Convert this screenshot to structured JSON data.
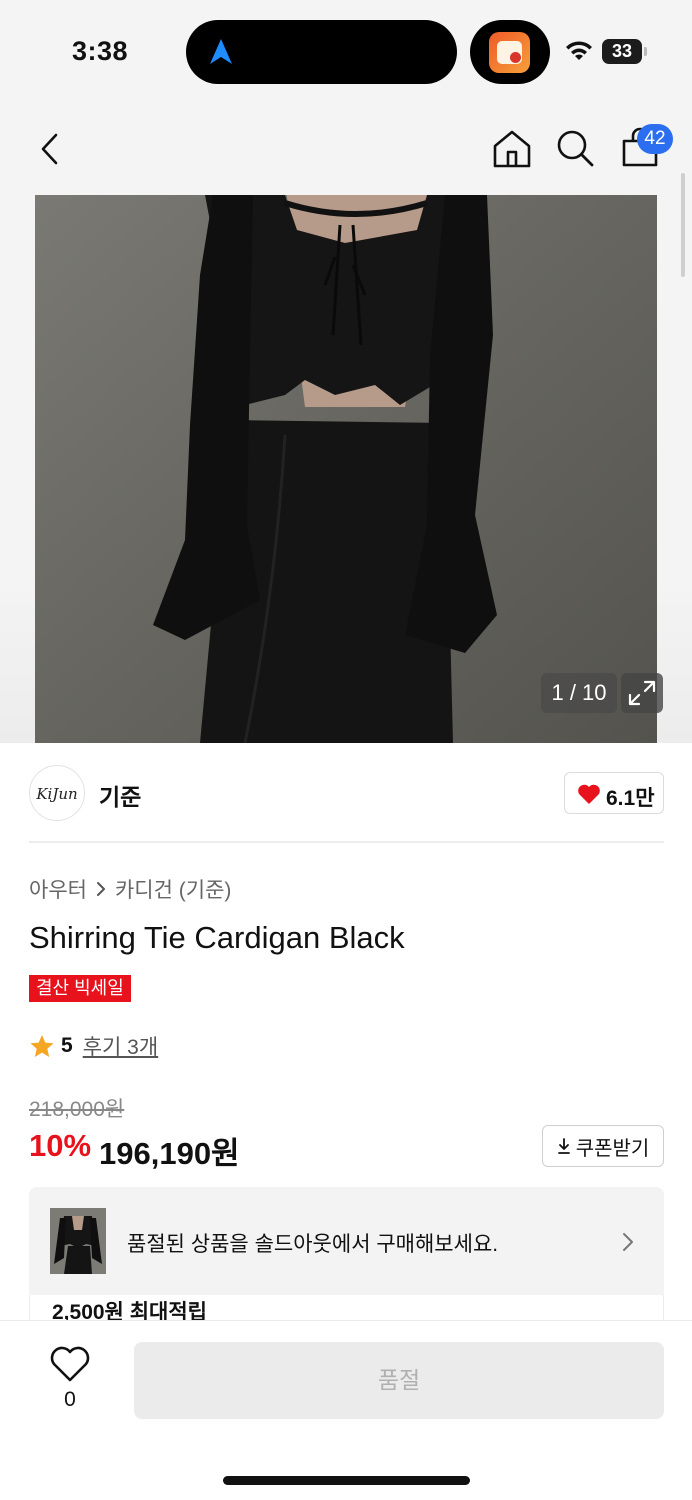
{
  "status_bar": {
    "time": "3:38",
    "battery": "33",
    "icons": [
      "navigation-arrow-icon",
      "app-icon",
      "wifi-icon",
      "battery-icon"
    ]
  },
  "header": {
    "icons": [
      "back-chevron-icon",
      "home-icon",
      "search-icon",
      "cart-bag-icon"
    ],
    "cart_badge": "42"
  },
  "gallery": {
    "counter": "1 / 10",
    "expand_icon": "expand-icon"
  },
  "brand": {
    "logo_text": "KiJun",
    "name": "기준",
    "likes": "6.1만",
    "heart_color": "#e8121c"
  },
  "product": {
    "breadcrumb": [
      "아우터",
      "카디건 (기준)"
    ],
    "title": "Shirring Tie Cardigan Black",
    "sale_tag": "결산 빅세일",
    "rating": "5",
    "review_link": "후기 3개",
    "original_price": "218,000원",
    "discount": "10%",
    "price": "196,190원",
    "coupon_label": "쿠폰받기"
  },
  "soldout_banner": {
    "text": "품절된 상품을 솔드아웃에서 구매해보세요."
  },
  "points": {
    "text": "2,500원 최대적립"
  },
  "bottom_bar": {
    "wish_count": "0",
    "buy_label": "품절"
  },
  "colors": {
    "accent_red": "#e8121c",
    "badge_blue": "#2b6ef0",
    "star": "#f5a623"
  }
}
